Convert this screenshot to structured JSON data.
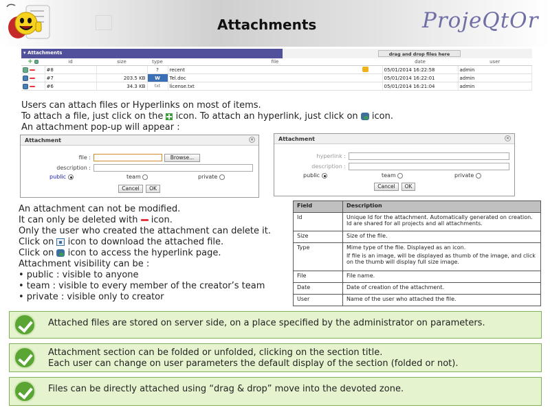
{
  "header": {
    "title": "Attachments",
    "brand": "ProjeQtOr"
  },
  "attachments": {
    "section_title": "Attachments",
    "dropzone_label": "drag and drop files here",
    "columns": [
      "id",
      "size",
      "type",
      "file",
      "date",
      "user"
    ],
    "rows": [
      {
        "id": "#8",
        "size": "",
        "type": "?",
        "file": "recent",
        "date": "05/01/2014 16:22:58",
        "user": "admin"
      },
      {
        "id": "#7",
        "size": "203.5 KB",
        "type": "W",
        "file": "Tel.doc",
        "date": "05/01/2014 16:22:01",
        "user": "admin"
      },
      {
        "id": "#6",
        "size": "34.3 KB",
        "type": "txt",
        "file": "license.txt",
        "date": "05/01/2014 16:21:04",
        "user": "admin"
      }
    ]
  },
  "intro": {
    "line1": "Users can attach files or Hyperlinks on most of items.",
    "line2a": "To attach a file, just click on the",
    "line2b": "icon. To attach an hyperlink, just click on",
    "line2c": "icon.",
    "line3": "An attachment pop-up will appear :"
  },
  "dialog_file": {
    "title": "Attachment",
    "file_label": "file :",
    "browse_label": "Browse...",
    "description_label": "description :",
    "public_label": "public",
    "team_label": "team",
    "private_label": "private",
    "cancel_label": "Cancel",
    "ok_label": "OK"
  },
  "dialog_link": {
    "title": "Attachment",
    "hyperlink_label": "hyperlink :",
    "description_label": "description :",
    "public_label": "public",
    "team_label": "team",
    "private_label": "private",
    "cancel_label": "Cancel",
    "ok_label": "OK"
  },
  "rules": {
    "line1": "An attachment can not be modified.",
    "line2a": "It can only be deleted with",
    "line2b": "icon.",
    "line3": "Only the user who created the attachment can delete it.",
    "line4a": "Click on",
    "line4b": "icon to download the attached file.",
    "line5a": "Click on",
    "line5b": "icon to access the hyperlink page.",
    "line6": "Attachment visibility can be :",
    "line7": "• public : visible to anyone",
    "line8": "• team : visible to every member of the creator’s team",
    "line9": "• private : visible only to creator"
  },
  "field_table": {
    "header_field": "Field",
    "header_description": "Description",
    "rows": [
      {
        "field": "Id",
        "desc": "Unique Id for the attachment. Automatically generated on creation. Id are shared for all projects and all attachments."
      },
      {
        "field": "Size",
        "desc": "Size of the file."
      },
      {
        "field": "Type",
        "desc": "Mime type of the file. Displayed as an icon.",
        "desc2": "If file is an image, will be displayed as thumb of the image, and click on the thumb will display full size image."
      },
      {
        "field": "File",
        "desc": "File name."
      },
      {
        "field": "Date",
        "desc": "Date of creation of the attachment."
      },
      {
        "field": "User",
        "desc": "Name of the user who attached the file."
      }
    ]
  },
  "tips": [
    {
      "line1": "Attached files are stored on server side, on a place specified by the administrator on parameters.",
      "line2": ""
    },
    {
      "line1": "Attachment section can be folded or unfolded, clicking on the section title.",
      "line2": "Each user can change on user parameters the default display of the section (folded or not)."
    },
    {
      "line1": "Files can be directly attached using “drag & drop” move into the devoted zone.",
      "line2": ""
    }
  ]
}
